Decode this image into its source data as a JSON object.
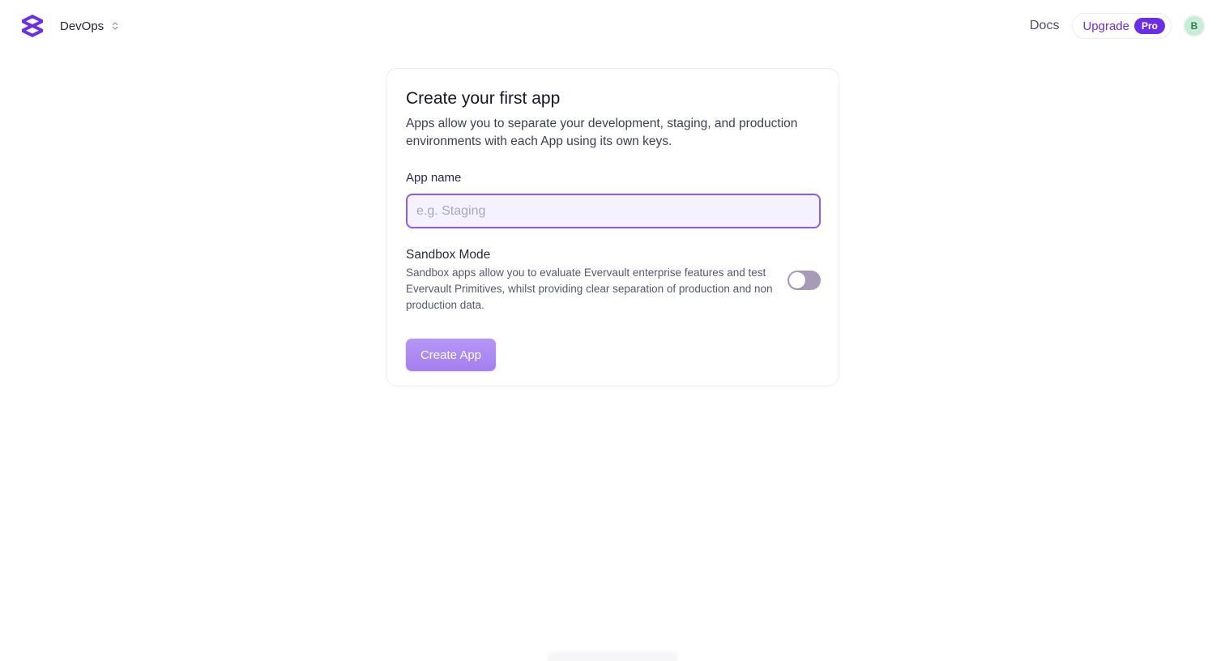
{
  "header": {
    "workspace_name": "DevOps",
    "docs_label": "Docs",
    "upgrade_label": "Upgrade",
    "pro_badge": "Pro",
    "avatar_initial": "B"
  },
  "card": {
    "title": "Create your first app",
    "description": "Apps allow you to separate your development, staging, and production environments with each App using its own keys.",
    "app_name_label": "App name",
    "app_name_placeholder": "e.g. Staging",
    "app_name_value": "",
    "sandbox_title": "Sandbox Mode",
    "sandbox_description": "Sandbox apps allow you to evaluate Evervault enterprise features and test Evervault Primitives, whilst providing clear separation of production and non production data.",
    "sandbox_enabled": false,
    "create_button_label": "Create App"
  },
  "colors": {
    "brand": "#6b2ee6",
    "input_focus_border": "#8a5cf0",
    "button_bg": "#a47ff0",
    "toggle_off": "#a79bb8"
  },
  "icons": {
    "logo": "evervault-logo-icon",
    "workspace_switch": "chevron-up-down-icon"
  }
}
